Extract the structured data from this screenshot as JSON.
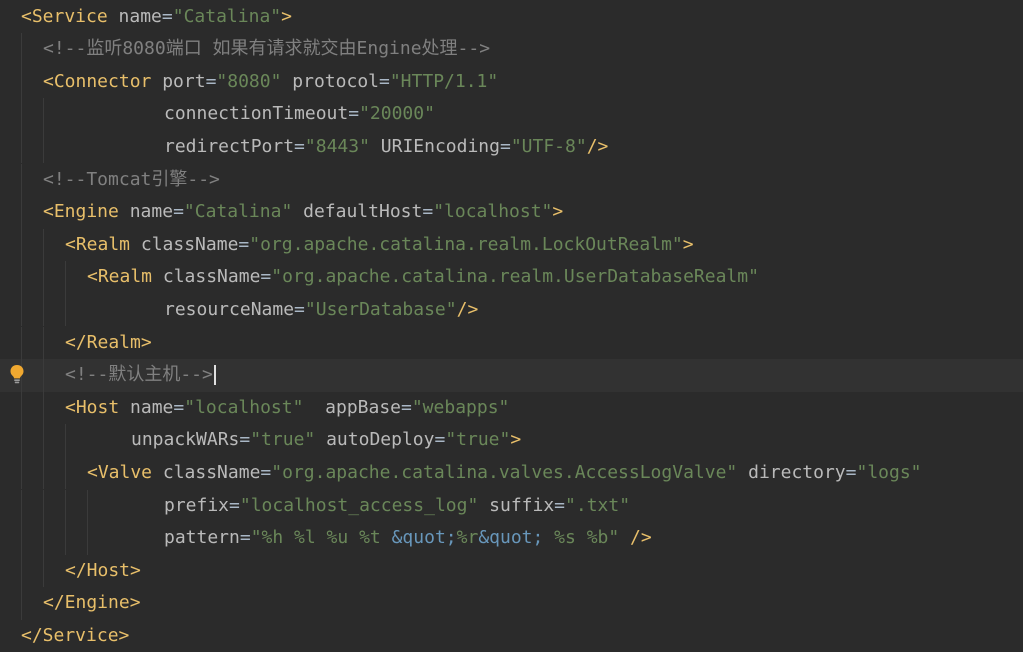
{
  "editor": {
    "language": "xml",
    "caret_line": 11,
    "lines": [
      [
        [
          "tag",
          "<Service"
        ],
        [
          "sp",
          " "
        ],
        [
          "attr",
          "name"
        ],
        [
          "eq",
          "="
        ],
        [
          "str",
          "\"Catalina\""
        ],
        [
          "tag",
          ">"
        ]
      ],
      [
        [
          "cmt",
          "<!--监听8080端口 如果有请求就交由Engine处理-->"
        ]
      ],
      [
        [
          "tag",
          "<Connector"
        ],
        [
          "sp",
          " "
        ],
        [
          "attr",
          "port"
        ],
        [
          "eq",
          "="
        ],
        [
          "str",
          "\"8080\""
        ],
        [
          "sp",
          " "
        ],
        [
          "attr",
          "protocol"
        ],
        [
          "eq",
          "="
        ],
        [
          "str",
          "\"HTTP/1.1\""
        ]
      ],
      [
        [
          "attr",
          "connectionTimeout"
        ],
        [
          "eq",
          "="
        ],
        [
          "str",
          "\"20000\""
        ]
      ],
      [
        [
          "attr",
          "redirectPort"
        ],
        [
          "eq",
          "="
        ],
        [
          "str",
          "\"8443\""
        ],
        [
          "sp",
          " "
        ],
        [
          "attr",
          "URIEncoding"
        ],
        [
          "eq",
          "="
        ],
        [
          "str",
          "\"UTF-8\""
        ],
        [
          "tag",
          "/>"
        ]
      ],
      [
        [
          "cmt",
          "<!--Tomcat引擎-->"
        ]
      ],
      [
        [
          "tag",
          "<Engine"
        ],
        [
          "sp",
          " "
        ],
        [
          "attr",
          "name"
        ],
        [
          "eq",
          "="
        ],
        [
          "str",
          "\"Catalina\""
        ],
        [
          "sp",
          " "
        ],
        [
          "attr",
          "defaultHost"
        ],
        [
          "eq",
          "="
        ],
        [
          "str",
          "\"localhost\""
        ],
        [
          "tag",
          ">"
        ]
      ],
      [
        [
          "tag",
          "<Realm"
        ],
        [
          "sp",
          " "
        ],
        [
          "attr",
          "className"
        ],
        [
          "eq",
          "="
        ],
        [
          "str",
          "\"org.apache.catalina.realm.LockOutRealm\""
        ],
        [
          "tag",
          ">"
        ]
      ],
      [
        [
          "tag",
          "<Realm"
        ],
        [
          "sp",
          " "
        ],
        [
          "attr",
          "className"
        ],
        [
          "eq",
          "="
        ],
        [
          "str",
          "\"org.apache.catalina.realm.UserDatabaseRealm\""
        ]
      ],
      [
        [
          "attr",
          "resourceName"
        ],
        [
          "eq",
          "="
        ],
        [
          "str",
          "\"UserDatabase\""
        ],
        [
          "tag",
          "/>"
        ]
      ],
      [
        [
          "tag",
          "</Realm>"
        ]
      ],
      [
        [
          "cmt",
          "<!--默认主机-->"
        ]
      ],
      [
        [
          "tag",
          "<Host"
        ],
        [
          "sp",
          " "
        ],
        [
          "attr",
          "name"
        ],
        [
          "eq",
          "="
        ],
        [
          "str",
          "\"localhost\""
        ],
        [
          "sp",
          "  "
        ],
        [
          "attr",
          "appBase"
        ],
        [
          "eq",
          "="
        ],
        [
          "str",
          "\"webapps\""
        ]
      ],
      [
        [
          "attr",
          "unpackWARs"
        ],
        [
          "eq",
          "="
        ],
        [
          "str",
          "\"true\""
        ],
        [
          "sp",
          " "
        ],
        [
          "attr",
          "autoDeploy"
        ],
        [
          "eq",
          "="
        ],
        [
          "str",
          "\"true\""
        ],
        [
          "tag",
          ">"
        ]
      ],
      [
        [
          "tag",
          "<Valve"
        ],
        [
          "sp",
          " "
        ],
        [
          "attr",
          "className"
        ],
        [
          "eq",
          "="
        ],
        [
          "str",
          "\"org.apache.catalina.valves.AccessLogValve\""
        ],
        [
          "sp",
          " "
        ],
        [
          "attr",
          "directory"
        ],
        [
          "eq",
          "="
        ],
        [
          "str",
          "\"logs\""
        ]
      ],
      [
        [
          "attr",
          "prefix"
        ],
        [
          "eq",
          "="
        ],
        [
          "str",
          "\"localhost_access_log\""
        ],
        [
          "sp",
          " "
        ],
        [
          "attr",
          "suffix"
        ],
        [
          "eq",
          "="
        ],
        [
          "str",
          "\".txt\""
        ]
      ],
      [
        [
          "attr",
          "pattern"
        ],
        [
          "eq",
          "="
        ],
        [
          "str",
          "\"%h %l %u %t "
        ],
        [
          "ent",
          "&quot;"
        ],
        [
          "str",
          "%r"
        ],
        [
          "ent",
          "&quot;"
        ],
        [
          "str",
          " %s %b\""
        ],
        [
          "sp",
          " "
        ],
        [
          "tag",
          "/>"
        ]
      ],
      [
        [
          "tag",
          "</Host>"
        ]
      ],
      [
        [
          "tag",
          "</Engine>"
        ]
      ],
      [
        [
          "tag",
          "</Service>"
        ]
      ]
    ],
    "intention_icon": "lightbulb-icon",
    "colors": {
      "background": "#2b2b2b",
      "current_line": "#323232",
      "tag": "#e8bf6a",
      "attribute": "#bababa",
      "string": "#6a8759",
      "entity": "#6897bb",
      "comment": "#808080",
      "bulb": "#f0a830"
    }
  }
}
